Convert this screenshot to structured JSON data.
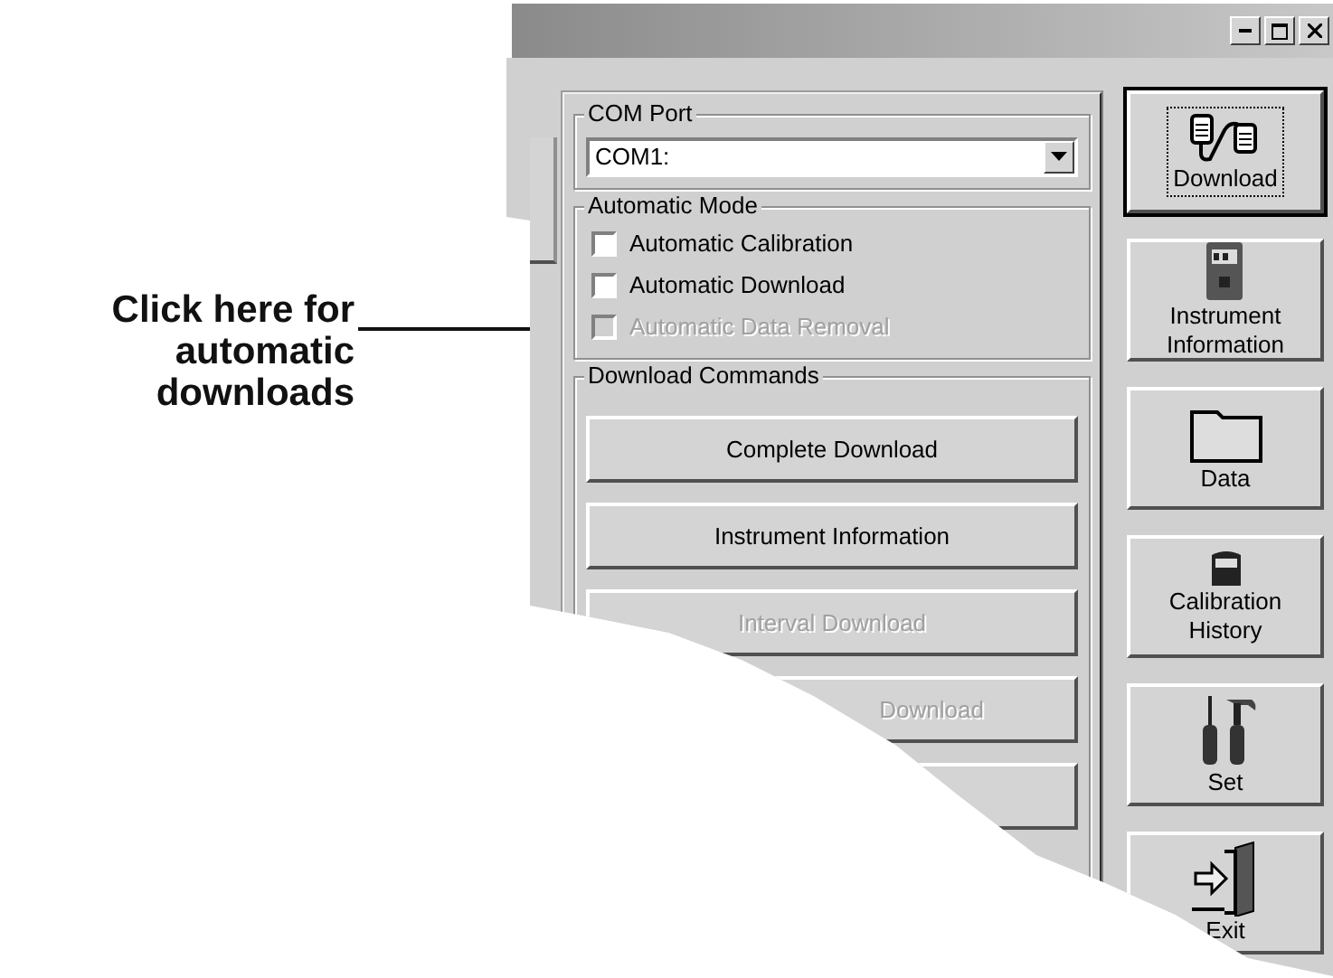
{
  "com_port": {
    "label": "COM Port",
    "value": "COM1:"
  },
  "automatic_mode": {
    "label": "Automatic Mode",
    "options": [
      {
        "label": "Automatic Calibration",
        "checked": false,
        "disabled": false
      },
      {
        "label": "Automatic Download",
        "checked": false,
        "disabled": false
      },
      {
        "label": "Automatic Data Removal",
        "checked": false,
        "disabled": true
      }
    ]
  },
  "download_commands": {
    "label": "Download Commands",
    "buttons": [
      {
        "kind": "text",
        "label": "Complete Download",
        "disabled": false
      },
      {
        "kind": "text",
        "label": "Instrument Information",
        "disabled": false
      },
      {
        "kind": "text",
        "label": "Interval Download",
        "disabled": true
      },
      {
        "kind": "text",
        "label": "Download",
        "disabled": true
      },
      {
        "kind": "blank"
      }
    ]
  },
  "sidebar": [
    {
      "label": "Download",
      "focused": true
    },
    {
      "label": "Instrument\nInformation",
      "focused": false
    },
    {
      "label": "Data",
      "focused": false
    },
    {
      "label": "Calibration\nHistory",
      "focused": false
    },
    {
      "label": "Set",
      "focused": false
    },
    {
      "label": "Exit",
      "focused": false
    }
  ],
  "callout": {
    "text": "Click here for\nautomatic\ndownloads"
  }
}
